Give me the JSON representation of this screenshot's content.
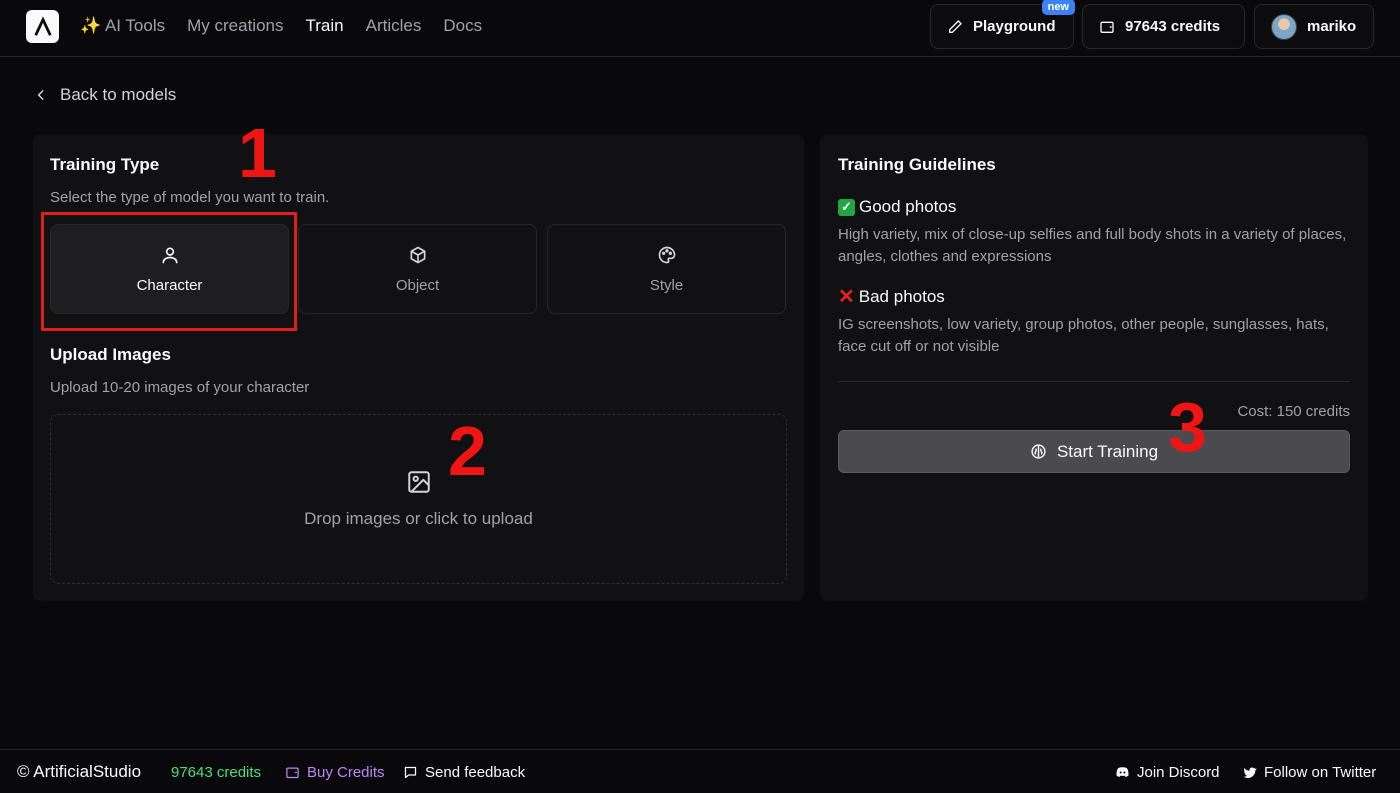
{
  "colors": {
    "background": "#09090b",
    "panel": "#111113",
    "annotation_red": "#e11d1d",
    "credits_green": "#4ade80",
    "buy_purple": "#c084fc",
    "new_badge_blue": "#3b82f6"
  },
  "header": {
    "logo_icon": "logo-icon",
    "nav": [
      {
        "label": "✨ AI Tools"
      },
      {
        "label": "My creations"
      },
      {
        "label": "Train",
        "active": true
      },
      {
        "label": "Articles"
      },
      {
        "label": "Docs"
      }
    ],
    "playground_label": "Playground",
    "playground_icon": "pencil-icon",
    "new_badge": "new",
    "credits_label": "97643 credits",
    "credits_icon": "wallet-icon",
    "user_name": "mariko"
  },
  "back_link": "Back to models",
  "training": {
    "title": "Training Type",
    "subtitle": "Select the type of model you want to train.",
    "types": [
      {
        "label": "Character",
        "icon": "user-icon",
        "selected": true
      },
      {
        "label": "Object",
        "icon": "box-icon",
        "selected": false
      },
      {
        "label": "Style",
        "icon": "palette-icon",
        "selected": false
      }
    ]
  },
  "upload": {
    "title": "Upload Images",
    "subtitle": "Upload 10-20 images of your character",
    "dropzone_text": "Drop images or click to upload",
    "icon": "image-icon"
  },
  "guidelines": {
    "title": "Training Guidelines",
    "good_title": "Good photos",
    "good_text": "High variety, mix of close-up selfies and full body shots in a variety of places, angles, clothes and expressions",
    "bad_title": "Bad photos",
    "bad_text": "IG screenshots, low variety, group photos, other people, sunglasses, hats, face cut off or not visible",
    "cost": "Cost: 150 credits",
    "start_label": "Start Training",
    "start_icon": "brain-icon"
  },
  "annotations": [
    "1",
    "2",
    "3"
  ],
  "footer": {
    "brand": "© ArtificialStudio",
    "credits": "97643 credits",
    "buy": "Buy Credits",
    "feedback": "Send feedback",
    "discord": "Join Discord",
    "twitter": "Follow on Twitter"
  }
}
